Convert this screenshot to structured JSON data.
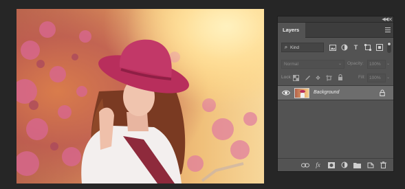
{
  "panel": {
    "title": "Layers",
    "filter": {
      "kind_label": "Kind",
      "search_glyph": "🔍"
    },
    "filter_icons": [
      "image-filter-icon",
      "adjustment-filter-icon",
      "type-filter-icon",
      "shape-filter-icon",
      "smart-object-filter-icon"
    ],
    "blend_mode": "Normal",
    "opacity_label": "Opacity:",
    "opacity_value": "100%",
    "lock_label": "Lock:",
    "fill_label": "Fill:",
    "fill_value": "100%",
    "layers": [
      {
        "name": "Background",
        "visible": true,
        "locked": true,
        "selected": true
      }
    ],
    "footer_icons": [
      "link-layers-icon",
      "fx-icon",
      "add-mask-icon",
      "adjustment-layer-icon",
      "new-group-icon",
      "new-layer-icon",
      "delete-layer-icon"
    ],
    "fx_text": "fx"
  },
  "colors": {
    "panel_bg": "#535353",
    "app_bg": "#262626",
    "selected_layer": "#6d6d6d",
    "hat": "#b82e5c"
  }
}
